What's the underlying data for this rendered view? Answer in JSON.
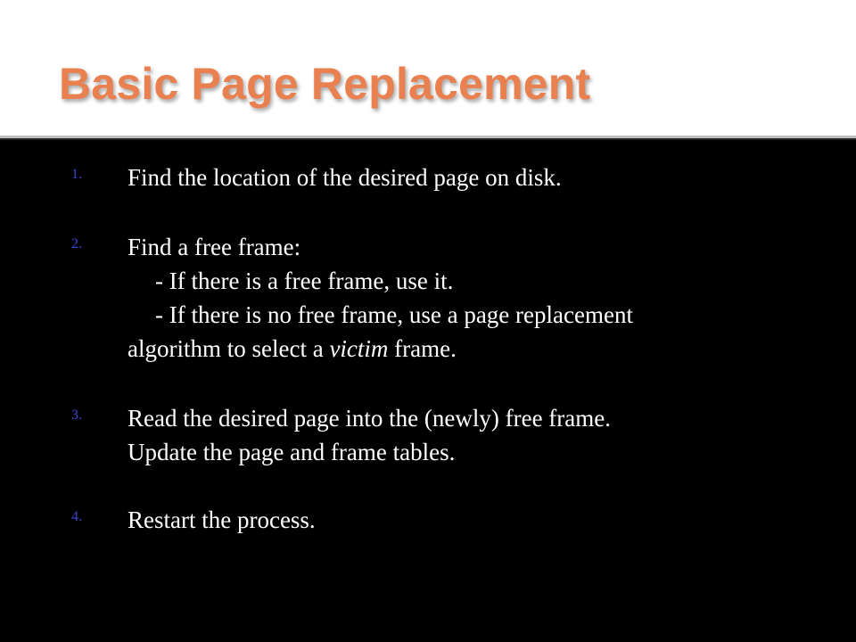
{
  "slide": {
    "title": "Basic Page Replacement",
    "colors": {
      "title": "#e8804f",
      "background": "#000000",
      "title_band": "#ffffff",
      "body_text": "#ffffff",
      "list_number": "#3b47c9"
    },
    "steps": [
      {
        "number": "1.",
        "lines": [
          "Find the location of the desired page on disk."
        ]
      },
      {
        "number": "2.",
        "lines": [
          "Find a free frame:",
          "- If there is a free frame, use it.",
          "- If there is no free frame, use a page replacement"
        ],
        "last_line": {
          "before": "algorithm to select a ",
          "emphasis": "victim",
          "after": " frame."
        }
      },
      {
        "number": "3.",
        "lines": [
          "Read the desired page into the (newly) free frame.",
          "Update the page and frame tables."
        ]
      },
      {
        "number": "4.",
        "lines": [
          "Restart the process."
        ]
      }
    ]
  }
}
